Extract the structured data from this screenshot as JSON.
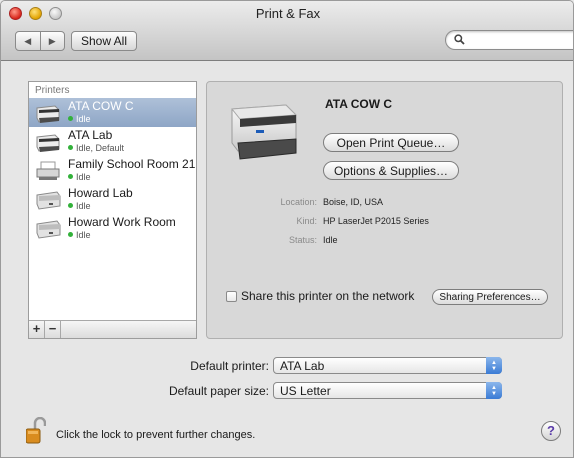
{
  "window": {
    "title": "Print & Fax"
  },
  "toolbar": {
    "back_icon": "back-arrow-icon",
    "forward_icon": "forward-arrow-icon",
    "show_all_label": "Show All",
    "search_placeholder": "",
    "search_icon": "search-icon"
  },
  "printers": {
    "header": "Printers",
    "items": [
      {
        "name": "ATA COW C",
        "status": "Idle",
        "selected": true
      },
      {
        "name": "ATA Lab",
        "status": "Idle, Default",
        "selected": false
      },
      {
        "name": "Family School Room 21",
        "status": "Idle",
        "selected": false
      },
      {
        "name": "Howard Lab",
        "status": "Idle",
        "selected": false
      },
      {
        "name": "Howard Work Room",
        "status": "Idle",
        "selected": false
      }
    ],
    "add_label": "+",
    "remove_label": "−"
  },
  "details": {
    "name": "ATA COW C",
    "open_queue_label": "Open Print Queue…",
    "options_label": "Options & Supplies…",
    "location_label": "Location:",
    "location_value": "Boise, ID, USA",
    "kind_label": "Kind:",
    "kind_value": "HP LaserJet P2015 Series",
    "status_label": "Status:",
    "status_value": "Idle",
    "share_label": "Share this printer on the network",
    "share_checked": false,
    "sharing_prefs_label": "Sharing Preferences…"
  },
  "defaults": {
    "printer_label": "Default printer:",
    "printer_value": "ATA Lab",
    "paper_label": "Default paper size:",
    "paper_value": "US Letter"
  },
  "footer": {
    "lock_text": "Click the lock to prevent further changes.",
    "help_label": "?"
  },
  "colors": {
    "selection": "#8ea6c6",
    "status_dot": "#32b13a",
    "popup_accent": "#3a7bd5"
  }
}
